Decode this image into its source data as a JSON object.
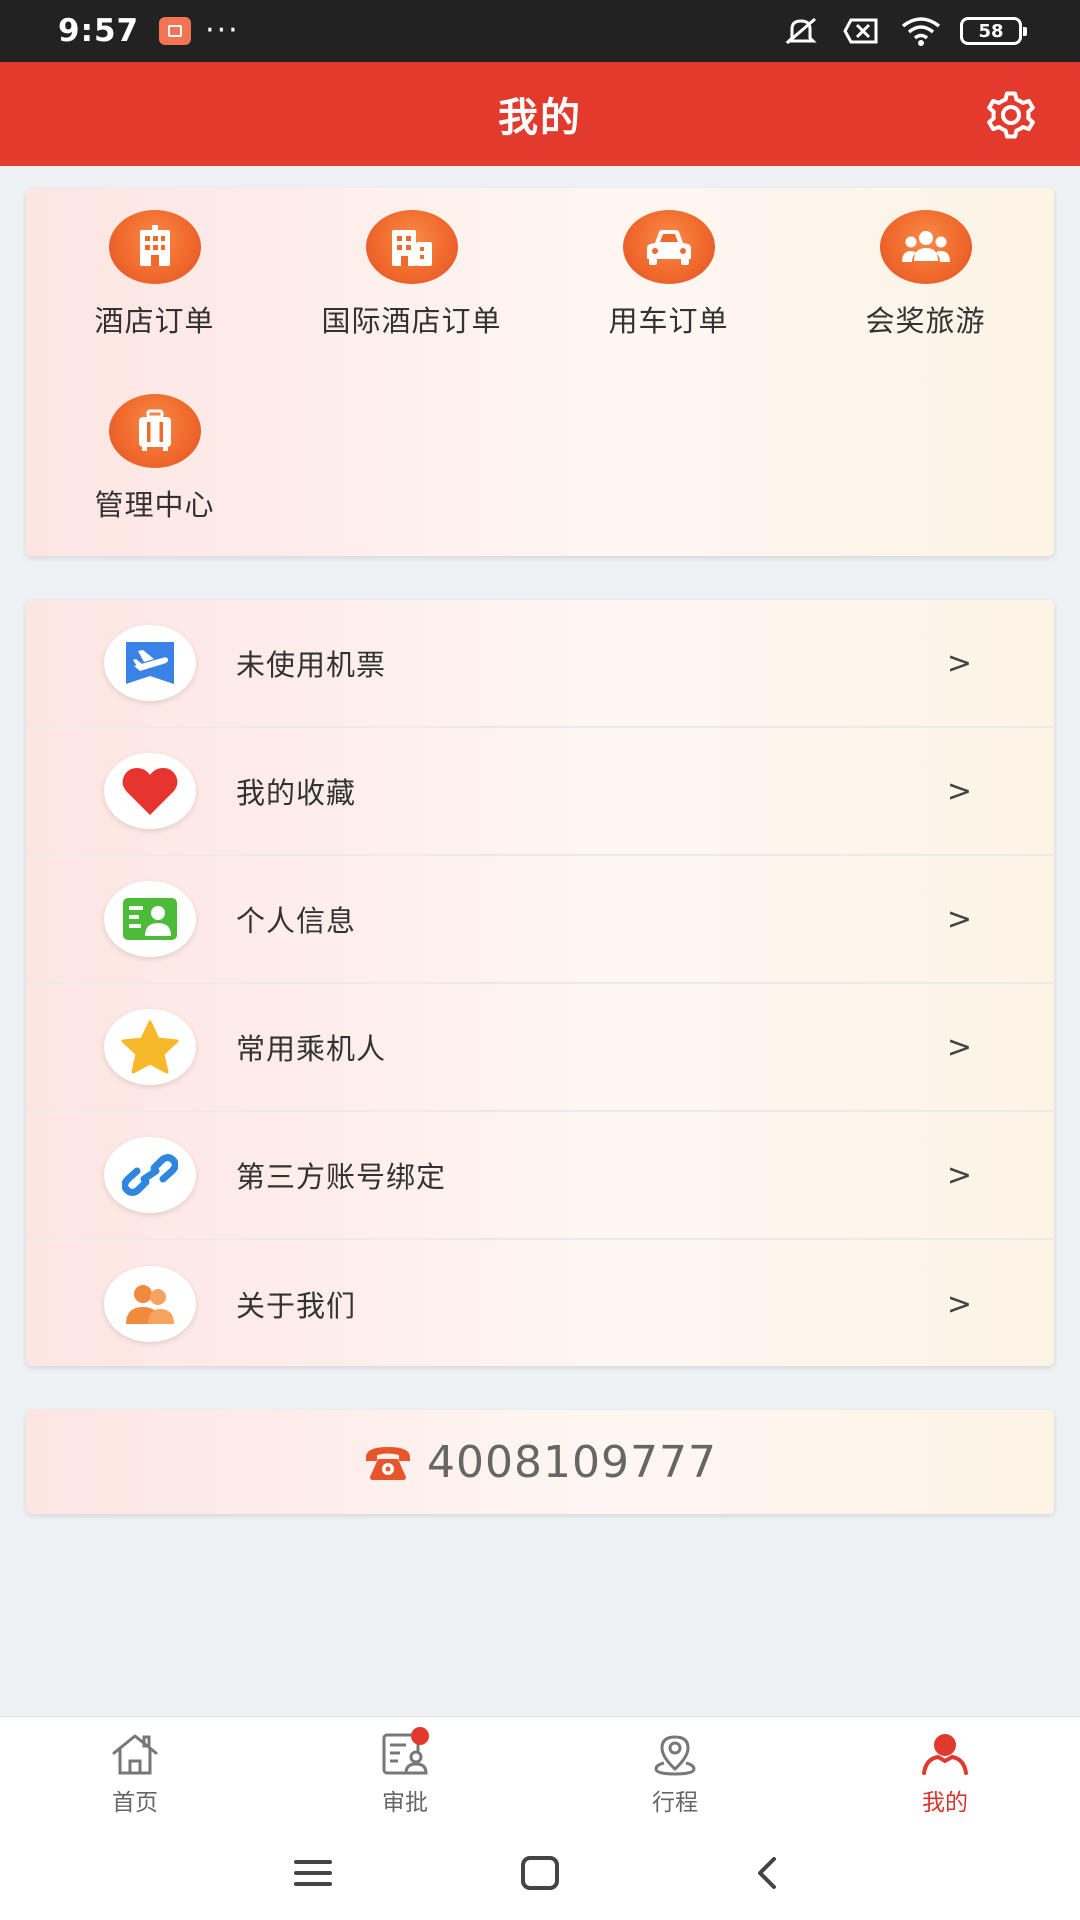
{
  "status_bar": {
    "time": "9:57",
    "battery": "58"
  },
  "header": {
    "title": "我的"
  },
  "quick_links": [
    {
      "label": "酒店订单",
      "icon": "hotel-icon"
    },
    {
      "label": "国际酒店订单",
      "icon": "international-hotel-icon"
    },
    {
      "label": "用车订单",
      "icon": "car-icon"
    },
    {
      "label": "会奖旅游",
      "icon": "group-travel-icon"
    },
    {
      "label": "管理中心",
      "icon": "briefcase-icon"
    }
  ],
  "menu": [
    {
      "label": "未使用机票",
      "icon": "plane-ticket-icon",
      "color": "#3b82e6"
    },
    {
      "label": "我的收藏",
      "icon": "heart-icon",
      "color": "#e8342f"
    },
    {
      "label": "个人信息",
      "icon": "id-card-icon",
      "color": "#4cbb3a"
    },
    {
      "label": "常用乘机人",
      "icon": "star-icon",
      "color": "#f7b82a"
    },
    {
      "label": "第三方账号绑定",
      "icon": "link-icon",
      "color": "#2e86de"
    },
    {
      "label": "关于我们",
      "icon": "people-icon",
      "color": "#f08a3c"
    }
  ],
  "chevron": ">",
  "phone": {
    "number": "4008109777",
    "color": "#e8552a"
  },
  "tabs": [
    {
      "label": "首页",
      "icon": "home-icon"
    },
    {
      "label": "审批",
      "icon": "approval-icon"
    },
    {
      "label": "行程",
      "icon": "itinerary-icon"
    },
    {
      "label": "我的",
      "icon": "profile-icon",
      "active": true
    }
  ],
  "colors": {
    "brand_red": "#e33a2e",
    "active_tab": "#d9352a",
    "icon_orange": "#f06a2c"
  }
}
